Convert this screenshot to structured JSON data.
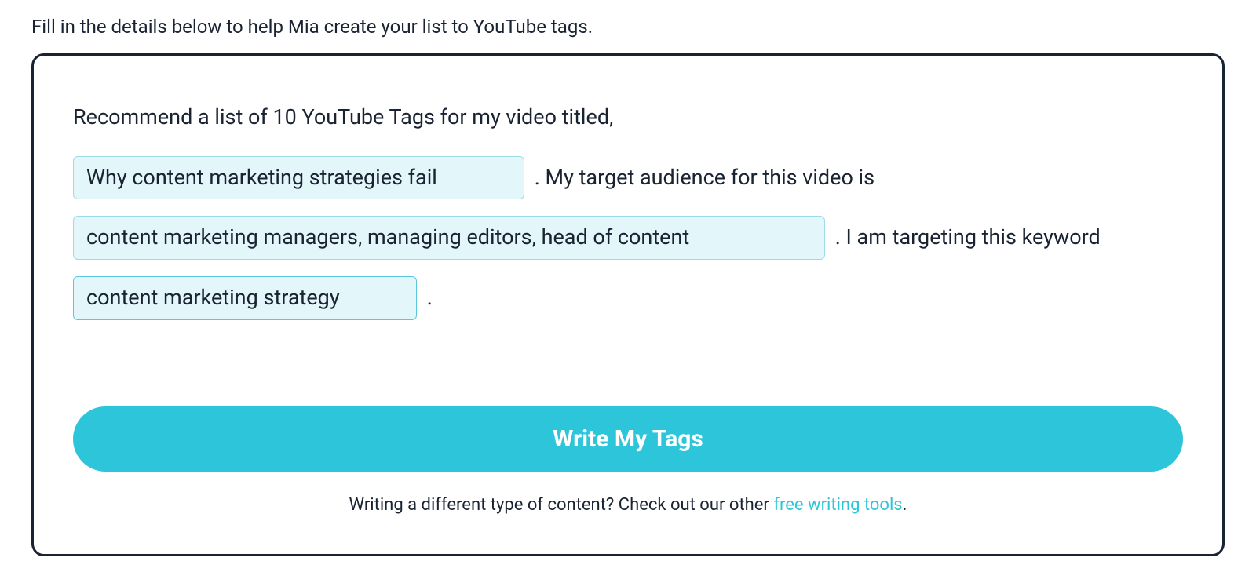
{
  "instruction": "Fill in the details below to help Mia create your list to YouTube tags.",
  "prompt": {
    "line1": "Recommend a list of 10 YouTube Tags for my video titled,",
    "segment2": ". My target audience for this video is",
    "segment3": ". I am targeting this keyword",
    "segment4": "."
  },
  "inputs": {
    "video_title": "Why content marketing strategies fail",
    "target_audience": "content marketing managers, managing editors, head of content",
    "keyword": "content marketing strategy"
  },
  "button": {
    "submit_label": "Write My Tags"
  },
  "footer": {
    "text_before": "Writing a different type of content? Check out our other ",
    "link_text": "free writing tools",
    "text_after": "."
  }
}
